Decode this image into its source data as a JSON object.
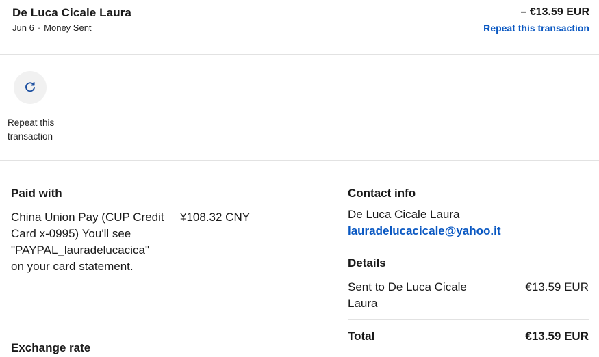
{
  "header": {
    "name": "De Luca Cicale Laura",
    "date": "Jun 6",
    "separator": "·",
    "type": "Money Sent",
    "amount": "– €13.59 EUR",
    "repeat_link": "Repeat this transaction"
  },
  "actions": {
    "repeat_icon": "refresh-icon",
    "repeat_label": "Repeat this transaction"
  },
  "paid_with": {
    "title": "Paid with",
    "method_line": "China Union Pay (CUP Credit Card x-0995)",
    "note": "You'll see \"PAYPAL_lauradelucacica\" on your card statement.",
    "amount": "¥108.32 CNY"
  },
  "exchange": {
    "title": "Exchange rate"
  },
  "contact": {
    "title": "Contact info",
    "name": "De Luca Cicale Laura",
    "email": "lauradelucacicale@yahoo.it"
  },
  "details": {
    "title": "Details",
    "sent_label": "Sent to De Luca Cicale Laura",
    "sent_amount": "€13.59 EUR",
    "total_label": "Total",
    "total_amount": "€13.59 EUR"
  },
  "colors": {
    "link": "#0a58c2",
    "divider": "#e2e2e2",
    "icon": "#1c4fa0"
  }
}
